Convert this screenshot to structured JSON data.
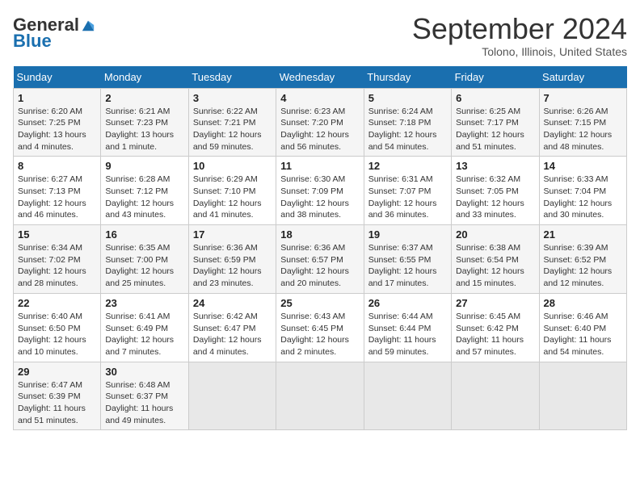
{
  "logo": {
    "general": "General",
    "blue": "Blue"
  },
  "title": {
    "month_year": "September 2024",
    "location": "Tolono, Illinois, United States"
  },
  "days_of_week": [
    "Sunday",
    "Monday",
    "Tuesday",
    "Wednesday",
    "Thursday",
    "Friday",
    "Saturday"
  ],
  "weeks": [
    [
      {
        "day": "1",
        "sunrise": "6:20 AM",
        "sunset": "7:25 PM",
        "daylight": "13 hours and 4 minutes."
      },
      {
        "day": "2",
        "sunrise": "6:21 AM",
        "sunset": "7:23 PM",
        "daylight": "13 hours and 1 minute."
      },
      {
        "day": "3",
        "sunrise": "6:22 AM",
        "sunset": "7:21 PM",
        "daylight": "12 hours and 59 minutes."
      },
      {
        "day": "4",
        "sunrise": "6:23 AM",
        "sunset": "7:20 PM",
        "daylight": "12 hours and 56 minutes."
      },
      {
        "day": "5",
        "sunrise": "6:24 AM",
        "sunset": "7:18 PM",
        "daylight": "12 hours and 54 minutes."
      },
      {
        "day": "6",
        "sunrise": "6:25 AM",
        "sunset": "7:17 PM",
        "daylight": "12 hours and 51 minutes."
      },
      {
        "day": "7",
        "sunrise": "6:26 AM",
        "sunset": "7:15 PM",
        "daylight": "12 hours and 48 minutes."
      }
    ],
    [
      {
        "day": "8",
        "sunrise": "6:27 AM",
        "sunset": "7:13 PM",
        "daylight": "12 hours and 46 minutes."
      },
      {
        "day": "9",
        "sunrise": "6:28 AM",
        "sunset": "7:12 PM",
        "daylight": "12 hours and 43 minutes."
      },
      {
        "day": "10",
        "sunrise": "6:29 AM",
        "sunset": "7:10 PM",
        "daylight": "12 hours and 41 minutes."
      },
      {
        "day": "11",
        "sunrise": "6:30 AM",
        "sunset": "7:09 PM",
        "daylight": "12 hours and 38 minutes."
      },
      {
        "day": "12",
        "sunrise": "6:31 AM",
        "sunset": "7:07 PM",
        "daylight": "12 hours and 36 minutes."
      },
      {
        "day": "13",
        "sunrise": "6:32 AM",
        "sunset": "7:05 PM",
        "daylight": "12 hours and 33 minutes."
      },
      {
        "day": "14",
        "sunrise": "6:33 AM",
        "sunset": "7:04 PM",
        "daylight": "12 hours and 30 minutes."
      }
    ],
    [
      {
        "day": "15",
        "sunrise": "6:34 AM",
        "sunset": "7:02 PM",
        "daylight": "12 hours and 28 minutes."
      },
      {
        "day": "16",
        "sunrise": "6:35 AM",
        "sunset": "7:00 PM",
        "daylight": "12 hours and 25 minutes."
      },
      {
        "day": "17",
        "sunrise": "6:36 AM",
        "sunset": "6:59 PM",
        "daylight": "12 hours and 23 minutes."
      },
      {
        "day": "18",
        "sunrise": "6:36 AM",
        "sunset": "6:57 PM",
        "daylight": "12 hours and 20 minutes."
      },
      {
        "day": "19",
        "sunrise": "6:37 AM",
        "sunset": "6:55 PM",
        "daylight": "12 hours and 17 minutes."
      },
      {
        "day": "20",
        "sunrise": "6:38 AM",
        "sunset": "6:54 PM",
        "daylight": "12 hours and 15 minutes."
      },
      {
        "day": "21",
        "sunrise": "6:39 AM",
        "sunset": "6:52 PM",
        "daylight": "12 hours and 12 minutes."
      }
    ],
    [
      {
        "day": "22",
        "sunrise": "6:40 AM",
        "sunset": "6:50 PM",
        "daylight": "12 hours and 10 minutes."
      },
      {
        "day": "23",
        "sunrise": "6:41 AM",
        "sunset": "6:49 PM",
        "daylight": "12 hours and 7 minutes."
      },
      {
        "day": "24",
        "sunrise": "6:42 AM",
        "sunset": "6:47 PM",
        "daylight": "12 hours and 4 minutes."
      },
      {
        "day": "25",
        "sunrise": "6:43 AM",
        "sunset": "6:45 PM",
        "daylight": "12 hours and 2 minutes."
      },
      {
        "day": "26",
        "sunrise": "6:44 AM",
        "sunset": "6:44 PM",
        "daylight": "11 hours and 59 minutes."
      },
      {
        "day": "27",
        "sunrise": "6:45 AM",
        "sunset": "6:42 PM",
        "daylight": "11 hours and 57 minutes."
      },
      {
        "day": "28",
        "sunrise": "6:46 AM",
        "sunset": "6:40 PM",
        "daylight": "11 hours and 54 minutes."
      }
    ],
    [
      {
        "day": "29",
        "sunrise": "6:47 AM",
        "sunset": "6:39 PM",
        "daylight": "11 hours and 51 minutes."
      },
      {
        "day": "30",
        "sunrise": "6:48 AM",
        "sunset": "6:37 PM",
        "daylight": "11 hours and 49 minutes."
      },
      null,
      null,
      null,
      null,
      null
    ]
  ]
}
